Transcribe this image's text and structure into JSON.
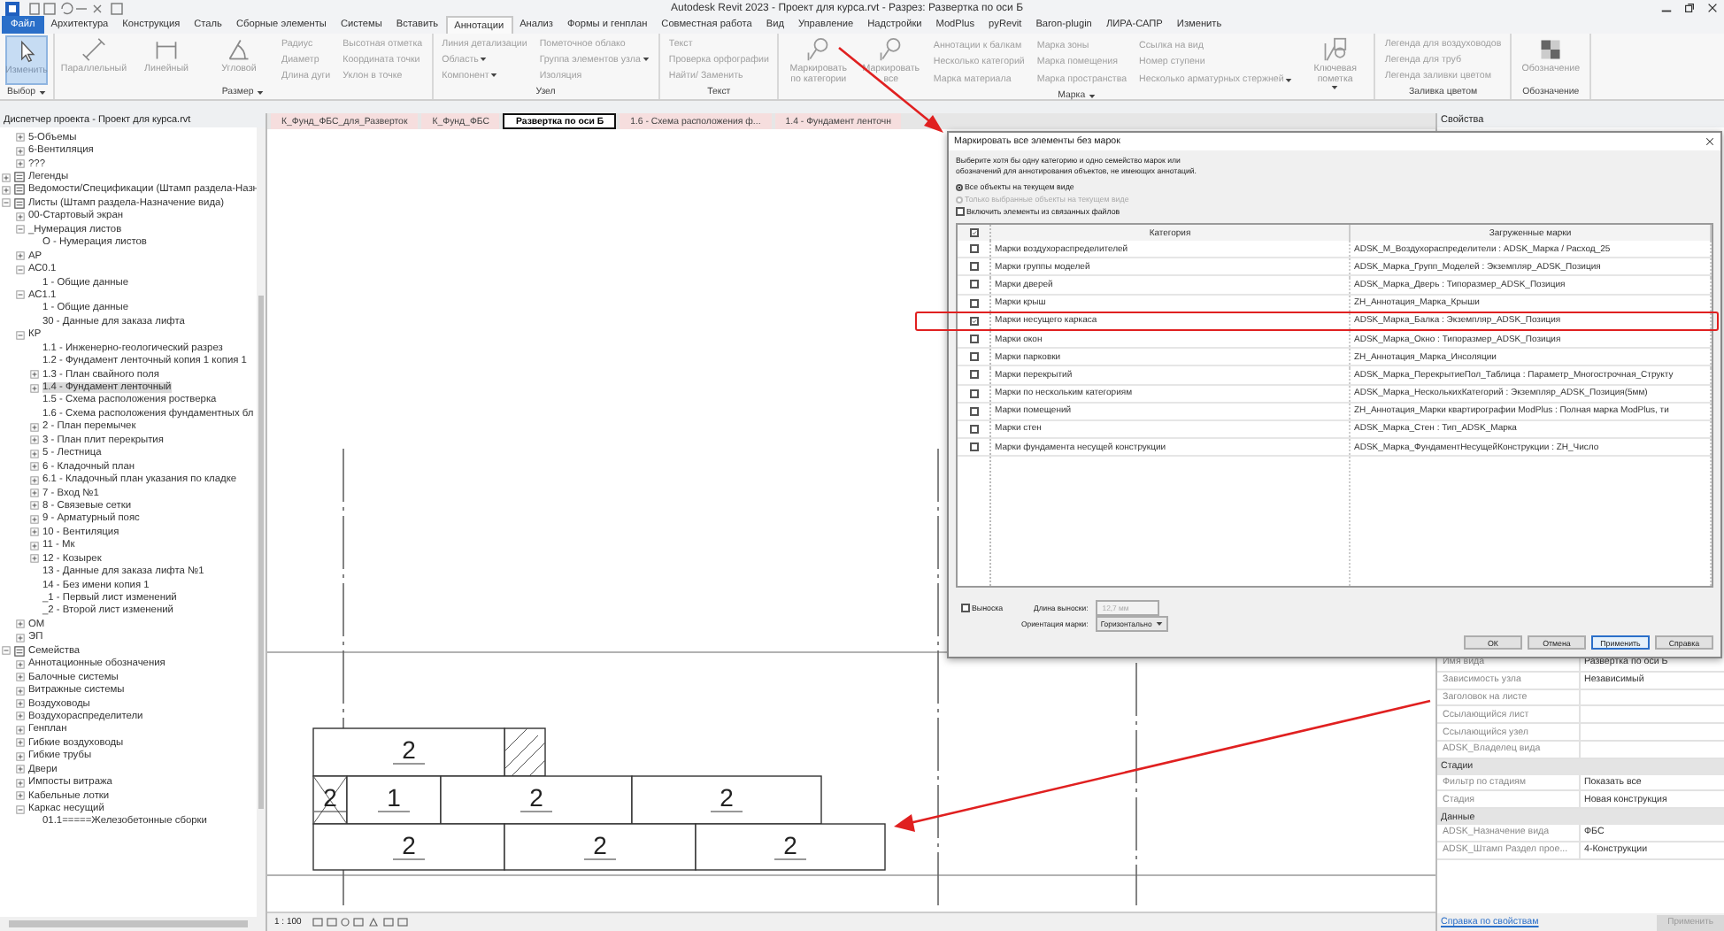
{
  "window": {
    "title": "Autodesk Revit 2023 - Проект для курса.rvt - Разрез: Развертка по оси Б"
  },
  "menu_tabs": [
    {
      "label": "Файл",
      "kind": "file",
      "selected": false
    },
    {
      "label": "Архитектура",
      "kind": "tab",
      "selected": false
    },
    {
      "label": "Конструкция",
      "kind": "tab",
      "selected": false
    },
    {
      "label": "Сталь",
      "kind": "tab",
      "selected": false
    },
    {
      "label": "Сборные элементы",
      "kind": "tab",
      "selected": false
    },
    {
      "label": "Системы",
      "kind": "tab",
      "selected": false
    },
    {
      "label": "Вставить",
      "kind": "tab",
      "selected": false
    },
    {
      "label": "Аннотации",
      "kind": "tab",
      "selected": true
    },
    {
      "label": "Анализ",
      "kind": "tab",
      "selected": false
    },
    {
      "label": "Формы и генплан",
      "kind": "tab",
      "selected": false
    },
    {
      "label": "Совместная работа",
      "kind": "tab",
      "selected": false
    },
    {
      "label": "Вид",
      "kind": "tab",
      "selected": false
    },
    {
      "label": "Управление",
      "kind": "tab",
      "selected": false
    },
    {
      "label": "Надстройки",
      "kind": "tab",
      "selected": false
    },
    {
      "label": "ModPlus",
      "kind": "tab",
      "selected": false
    },
    {
      "label": "pyRevit",
      "kind": "tab",
      "selected": false
    },
    {
      "label": "Baron-plugin",
      "kind": "tab",
      "selected": false
    },
    {
      "label": "ЛИРА-САПР",
      "kind": "tab",
      "selected": false
    },
    {
      "label": "Изменить",
      "kind": "tab",
      "selected": false
    }
  ],
  "ribbon": [
    {
      "label": "Выбор",
      "dropdown": true,
      "items": [
        {
          "kind": "large",
          "label": "Изменить",
          "selected": true,
          "dropdown": false
        }
      ]
    },
    {
      "label": "Размер",
      "dropdown": true,
      "items": [
        {
          "kind": "large",
          "label": "Параллельный",
          "selected": false,
          "dropdown": false
        },
        {
          "kind": "large",
          "label": "Линейный",
          "selected": false,
          "dropdown": false
        },
        {
          "kind": "large",
          "label": "Угловой",
          "selected": false,
          "dropdown": false
        },
        {
          "kind": "column",
          "entries": [
            {
              "label": "Радиус",
              "dropdown": false
            },
            {
              "label": "Диаметр",
              "dropdown": false
            },
            {
              "label": "Длина дуги",
              "dropdown": false
            }
          ]
        },
        {
          "kind": "column",
          "entries": [
            {
              "label": "Высотная отметка",
              "dropdown": false
            },
            {
              "label": "Координата точки",
              "dropdown": false
            },
            {
              "label": "Уклон в точке",
              "dropdown": false
            }
          ]
        }
      ]
    },
    {
      "label": "Узел",
      "dropdown": false,
      "items": [
        {
          "kind": "column",
          "entries": [
            {
              "label": "Линия детализации",
              "dropdown": false
            },
            {
              "label": "Область",
              "dropdown": true
            },
            {
              "label": "Компонент",
              "dropdown": true
            }
          ]
        },
        {
          "kind": "column",
          "entries": [
            {
              "label": "Пометочное облако",
              "dropdown": false
            },
            {
              "label": "Группа элементов узла",
              "dropdown": true
            },
            {
              "label": "Изоляция",
              "dropdown": false
            }
          ]
        }
      ]
    },
    {
      "label": "Текст",
      "dropdown": false,
      "items": [
        {
          "kind": "column",
          "entries": [
            {
              "label": "Текст",
              "dropdown": false
            },
            {
              "label": "Проверка орфографии",
              "dropdown": false
            },
            {
              "label": "Найти/ Заменить",
              "dropdown": false
            }
          ]
        }
      ]
    },
    {
      "label": "Марка",
      "dropdown": true,
      "items": [
        {
          "kind": "large",
          "label": "Маркировать по категории",
          "selected": false,
          "dropdown": false
        },
        {
          "kind": "large",
          "label": "Маркировать все",
          "selected": false,
          "dropdown": false
        },
        {
          "kind": "column",
          "entries": [
            {
              "label": "Аннотации к балкам",
              "dropdown": false
            },
            {
              "label": "Несколько категорий",
              "dropdown": false
            },
            {
              "label": "Марка материала",
              "dropdown": false
            }
          ]
        },
        {
          "kind": "column",
          "entries": [
            {
              "label": "Марка зоны",
              "dropdown": false
            },
            {
              "label": "Марка помещения",
              "dropdown": false
            },
            {
              "label": "Марка пространства",
              "dropdown": false
            }
          ]
        },
        {
          "kind": "column",
          "entries": [
            {
              "label": "Ссылка на вид",
              "dropdown": false
            },
            {
              "label": "Номер ступени",
              "dropdown": false
            },
            {
              "label": "Несколько арматурных стержней",
              "dropdown": true
            }
          ]
        },
        {
          "kind": "large",
          "label": "Ключевая пометка",
          "selected": false,
          "dropdown": true
        }
      ]
    },
    {
      "label": "Заливка цветом",
      "dropdown": false,
      "items": [
        {
          "kind": "column",
          "entries": [
            {
              "label": "Легенда для воздуховодов",
              "dropdown": false
            },
            {
              "label": "Легенда для труб",
              "dropdown": false
            },
            {
              "label": "Легенда заливки цветом",
              "dropdown": false
            }
          ]
        }
      ]
    },
    {
      "label": "Обозначение",
      "dropdown": false,
      "items": [
        {
          "kind": "large",
          "label": "Обозначение",
          "selected": false,
          "dropdown": false
        }
      ]
    }
  ],
  "project_browser": {
    "title": "Диспетчер проекта - Проект для курса.rvt",
    "continued_items": [
      {
        "label": "5-Объемы",
        "expanded": false,
        "selected": false
      },
      {
        "label": "6-Вентиляция",
        "expanded": false,
        "selected": false
      },
      {
        "label": "???",
        "expanded": false,
        "selected": false
      }
    ],
    "items": [
      {
        "label": "Легенды",
        "kind": "category",
        "expanded": false,
        "selected": false
      },
      {
        "label": "Ведомости/Спецификации (Штамп раздела-Назн",
        "kind": "category",
        "expanded": false,
        "selected": false
      },
      {
        "label": "Листы (Штамп раздела-Назначение вида)",
        "kind": "category",
        "expanded": true,
        "selected": false,
        "children": [
          {
            "label": "00-Стартовый экран",
            "expanded": false,
            "selected": false
          },
          {
            "label": "_Нумерация листов",
            "expanded": true,
            "selected": false,
            "children": [
              {
                "label": "О - Нумерация листов",
                "selected": false
              }
            ]
          },
          {
            "label": "АР",
            "expanded": false,
            "selected": false
          },
          {
            "label": "АС0.1",
            "expanded": true,
            "selected": false,
            "children": [
              {
                "label": "1 - Общие данные",
                "selected": false
              }
            ]
          },
          {
            "label": "АС1.1",
            "expanded": true,
            "selected": false,
            "children": [
              {
                "label": "1 - Общие данные",
                "selected": false
              },
              {
                "label": "30 - Данные для заказа лифта",
                "selected": false
              }
            ]
          },
          {
            "label": "КР",
            "expanded": true,
            "selected": false,
            "children": [
              {
                "label": "1.1 - Инженерно-геологический разрез",
                "selected": false
              },
              {
                "label": "1.2 - Фундамент ленточный копия 1 копия 1",
                "selected": false
              },
              {
                "label": "1.3 - План свайного поля",
                "expanded": false,
                "selected": false
              },
              {
                "label": "1.4 - Фундамент ленточный",
                "expanded": false,
                "selected": true
              },
              {
                "label": "1.5 - Схема расположения ростверка",
                "selected": false
              },
              {
                "label": "1.6 - Схема расположения фундаментных бл",
                "selected": false
              },
              {
                "label": "2 - План перемычек",
                "expanded": false,
                "selected": false
              },
              {
                "label": "3 - План плит перекрытия",
                "expanded": false,
                "selected": false
              },
              {
                "label": "5 - Лестница",
                "expanded": false,
                "selected": false
              },
              {
                "label": "6 - Кладочный план",
                "expanded": false,
                "selected": false
              },
              {
                "label": "6.1 - Кладочный план указания по кладке",
                "expanded": false,
                "selected": false
              },
              {
                "label": "7 - Вход №1",
                "expanded": false,
                "selected": false
              },
              {
                "label": "8 - Связевые сетки",
                "expanded": false,
                "selected": false
              },
              {
                "label": "9 - Арматурный пояс",
                "expanded": false,
                "selected": false
              },
              {
                "label": "10 - Вентиляция",
                "expanded": false,
                "selected": false
              },
              {
                "label": "11 - Мк",
                "expanded": false,
                "selected": false
              },
              {
                "label": "12 - Козырек",
                "expanded": false,
                "selected": false
              },
              {
                "label": "13 - Данные для заказа лифта №1",
                "selected": false
              },
              {
                "label": "14 - Без имени копия 1",
                "selected": false
              },
              {
                "label": "_1 - Первый лист изменений",
                "selected": false
              },
              {
                "label": "_2 - Второй лист изменений",
                "selected": false
              }
            ]
          },
          {
            "label": "ОМ",
            "expanded": false,
            "selected": false
          },
          {
            "label": "ЭП",
            "expanded": false,
            "selected": false
          }
        ]
      },
      {
        "label": "Семейства",
        "kind": "category",
        "expanded": true,
        "selected": false,
        "children": [
          {
            "label": "Аннотационные обозначения",
            "expanded": false,
            "selected": false
          },
          {
            "label": "Балочные системы",
            "expanded": false,
            "selected": false
          },
          {
            "label": "Витражные системы",
            "expanded": false,
            "selected": false
          },
          {
            "label": "Воздуховоды",
            "expanded": false,
            "selected": false
          },
          {
            "label": "Воздухораспределители",
            "expanded": false,
            "selected": false
          },
          {
            "label": "Генплан",
            "expanded": false,
            "selected": false
          },
          {
            "label": "Гибкие воздуховоды",
            "expanded": false,
            "selected": false
          },
          {
            "label": "Гибкие трубы",
            "expanded": false,
            "selected": false
          },
          {
            "label": "Двери",
            "expanded": false,
            "selected": false
          },
          {
            "label": "Импосты витража",
            "expanded": false,
            "selected": false
          },
          {
            "label": "Кабельные лотки",
            "expanded": false,
            "selected": false
          },
          {
            "label": "Каркас несущий",
            "expanded": true,
            "selected": false,
            "children": [
              {
                "label": "01.1=====Железобетонные сборки",
                "selected": false
              }
            ]
          }
        ]
      }
    ]
  },
  "view_tabs": [
    {
      "label": "К_Фунд_ФБС_для_Разверток",
      "selected": false
    },
    {
      "label": "К_Фунд_ФБС",
      "selected": false
    },
    {
      "label": "Развертка по оси Б",
      "selected": true
    },
    {
      "label": "1.6 - Схема расположения ф...",
      "selected": false
    },
    {
      "label": "1.4 - Фундамент ленточн",
      "selected": false
    }
  ],
  "drawing": {
    "marks": [
      "2",
      "2",
      "1",
      "2",
      "2",
      "2",
      "2",
      "2"
    ]
  },
  "view_status": {
    "scale": "1 : 100"
  },
  "properties": {
    "title": "Свойства",
    "rows": [
      {
        "kind": "field",
        "label": "Имя вида",
        "value": "Развертка по оси Б"
      },
      {
        "kind": "field",
        "label": "Зависимость узла",
        "value": "Независимый"
      },
      {
        "kind": "field",
        "label": "Заголовок на листе"
      },
      {
        "kind": "field",
        "label": "Ссылающийся лист"
      },
      {
        "kind": "field",
        "label": "Ссылающийся узел"
      },
      {
        "kind": "field",
        "label": "ADSK_Владелец вида"
      },
      {
        "kind": "section",
        "label": "Стадии"
      },
      {
        "kind": "field",
        "label": "Фильтр по стадиям",
        "value": "Показать все"
      },
      {
        "kind": "field",
        "label": "Стадия",
        "value": "Новая конструкция"
      },
      {
        "kind": "section",
        "label": "Данные"
      },
      {
        "kind": "field",
        "label": "ADSK_Назначение вида",
        "value": "ФБС"
      },
      {
        "kind": "field",
        "label": "ADSK_Штамп Раздел прое...",
        "value": "4-Конструкции"
      }
    ],
    "help_link": "Справка по свойствам",
    "apply_button": "Применить"
  },
  "dialog": {
    "title": "Маркировать все элементы без марок",
    "instructions": "Выберите хотя бы одну категорию и одно семейство марок или обозначений для аннотирования объектов, не имеющих аннотаций.",
    "scope_options": [
      {
        "label": "Все объекты на текущем виде",
        "selected": true,
        "disabled": false
      },
      {
        "label": "Только выбранные объекты на текущем виде",
        "selected": false,
        "disabled": true
      }
    ],
    "include_linked": {
      "label": "Включить элементы из связанных файлов",
      "checked": false
    },
    "table": {
      "select_all_checked": true,
      "columns": [
        "Категория",
        "Загруженные марки"
      ],
      "rows": [
        {
          "category": "Марки воздухораспределителей",
          "tags": "ADSK_M_Воздухораспределители : ADSK_Марка / Расход_25",
          "checked": false,
          "highlighted": false
        },
        {
          "category": "Марки группы моделей",
          "tags": "ADSK_Марка_Групп_Моделей : Экземпляр_ADSK_Позиция",
          "checked": false,
          "highlighted": false
        },
        {
          "category": "Марки дверей",
          "tags": "ADSK_Марка_Дверь : Типоразмер_ADSK_Позиция",
          "checked": false,
          "highlighted": false
        },
        {
          "category": "Марки крыш",
          "tags": "ZH_Аннотация_Марка_Крыши",
          "checked": false,
          "highlighted": false
        },
        {
          "category": "Марки несущего каркаса",
          "tags": "ADSK_Марка_Балка : Экземпляр_ADSK_Позиция",
          "checked": true,
          "highlighted": true
        },
        {
          "category": "Марки окон",
          "tags": "ADSK_Марка_Окно : Типоразмер_ADSK_Позиция",
          "checked": false,
          "highlighted": false
        },
        {
          "category": "Марки парковки",
          "tags": "ZH_Аннотация_Марка_Инсоляции",
          "checked": false,
          "highlighted": false
        },
        {
          "category": "Марки перекрытий",
          "tags": "ADSK_Марка_ПерекрытиеПол_Таблица : Параметр_Многострочная_Структу",
          "checked": false,
          "highlighted": false
        },
        {
          "category": "Марки по нескольким категориям",
          "tags": "ADSK_Марка_НесколькихКатегорий : Экземпляр_ADSK_Позиция(5мм)",
          "checked": false,
          "highlighted": false
        },
        {
          "category": "Марки помещений",
          "tags": "ZH_Аннотация_Марки квартирографии ModPlus : Полная марка ModPlus, ти",
          "checked": false,
          "highlighted": false
        },
        {
          "category": "Марки стен",
          "tags": "ADSK_Марка_Стен : Тип_ADSK_Марка",
          "checked": false,
          "highlighted": false
        },
        {
          "category": "Марки фундамента несущей конструкции",
          "tags": "ADSK_Марка_ФундаментНесущейКонструкции : ZH_Число",
          "checked": false,
          "highlighted": false
        }
      ]
    },
    "leader": {
      "label": "Выноска",
      "checked": false
    },
    "leader_length": {
      "label": "Длина выноски:",
      "value": "12,7 мм",
      "disabled": true
    },
    "orientation": {
      "label": "Ориентация марки:",
      "value": "Горизонтально"
    },
    "buttons": [
      {
        "label": "ОК",
        "default": false
      },
      {
        "label": "Отмена",
        "default": false
      },
      {
        "label": "Применить",
        "default": true
      },
      {
        "label": "Справка",
        "default": false
      }
    ]
  }
}
